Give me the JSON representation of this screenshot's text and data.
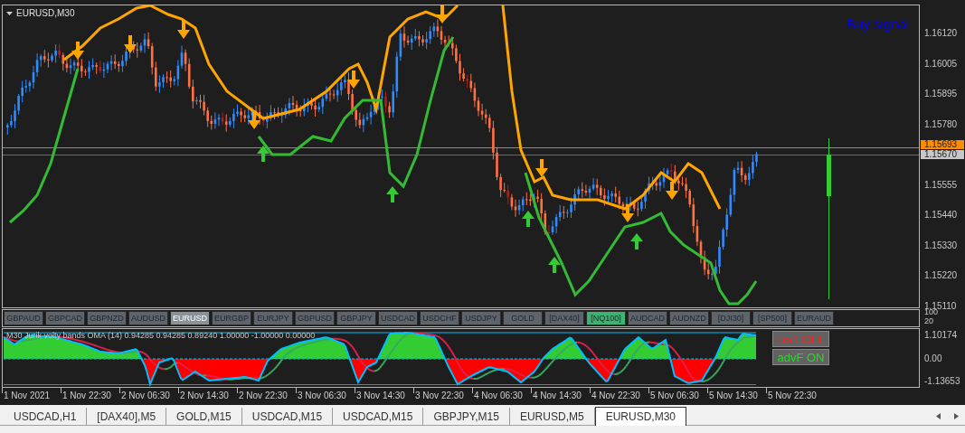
{
  "chart": {
    "symbol": "EURUSD,M30",
    "signal": "Buy signal"
  },
  "price_axis": {
    "ticks": [
      "1.16120",
      "1.16005",
      "1.15895",
      "1.15780",
      "1.15555",
      "1.15440",
      "1.15330",
      "1.15220",
      "1.15110"
    ],
    "bid_tag": "1.15693",
    "last_tag": "1.15670"
  },
  "symbol_buttons": [
    {
      "label": "GBPAUD",
      "selected": false,
      "highlighted": false
    },
    {
      "label": "GBPCAD",
      "selected": false,
      "highlighted": false
    },
    {
      "label": "GBPNZD",
      "selected": false,
      "highlighted": false
    },
    {
      "label": "AUDUSD",
      "selected": false,
      "highlighted": false
    },
    {
      "label": "EURUSD",
      "selected": true,
      "highlighted": false
    },
    {
      "label": "EURGBP",
      "selected": false,
      "highlighted": false
    },
    {
      "label": "EURJPY",
      "selected": false,
      "highlighted": false
    },
    {
      "label": "GBPUSD",
      "selected": false,
      "highlighted": false
    },
    {
      "label": "GBPJPY",
      "selected": false,
      "highlighted": false
    },
    {
      "label": "USDCAD",
      "selected": false,
      "highlighted": false
    },
    {
      "label": "USDCHF",
      "selected": false,
      "highlighted": false
    },
    {
      "label": "USDJPY",
      "selected": false,
      "highlighted": false
    },
    {
      "label": "GOLD",
      "selected": false,
      "highlighted": false
    },
    {
      "label": "[DAX40]",
      "selected": false,
      "highlighted": false
    },
    {
      "label": "[NQ100]",
      "selected": false,
      "highlighted": true
    },
    {
      "label": "AUDCAD",
      "selected": false,
      "highlighted": false
    },
    {
      "label": "AUDNZD",
      "selected": false,
      "highlighted": false
    },
    {
      "label": "[DJI30]",
      "selected": false,
      "highlighted": false
    },
    {
      "label": "[SP500]",
      "selected": false,
      "highlighted": false
    },
    {
      "label": "EURAUD",
      "selected": false,
      "highlighted": false
    }
  ],
  "button_axis": [
    "100",
    "20"
  ],
  "indicator": {
    "title": "M30 Jurik volty bands OMA (14) 0.94285 0.94285 0.89240 1.00000 -1.00000 0.00000",
    "toggles": [
      {
        "label": "Lrs1 OFF",
        "on": false
      },
      {
        "label": "advF ON",
        "on": true
      }
    ],
    "axis": [
      "1.10174",
      "0.00",
      "-1.13653"
    ]
  },
  "time_axis": [
    "1 Nov 2021",
    "1 Nov 22:30",
    "2 Nov 06:30",
    "2 Nov 14:30",
    "2 Nov 22:30",
    "3 Nov 06:30",
    "3 Nov 14:30",
    "3 Nov 22:30",
    "4 Nov 06:30",
    "4 Nov 14:30",
    "4 Nov 22:30",
    "5 Nov 06:30",
    "5 Nov 14:30",
    "5 Nov 22:30"
  ],
  "tabs": [
    {
      "label": "USDCAD,H1",
      "selected": false
    },
    {
      "label": "[DAX40],M5",
      "selected": false
    },
    {
      "label": "GOLD,M15",
      "selected": false
    },
    {
      "label": "USDCAD,M15",
      "selected": false
    },
    {
      "label": "USDCAD,M15",
      "selected": false
    },
    {
      "label": "GBPJPY,M15",
      "selected": false
    },
    {
      "label": "EURUSD,M5",
      "selected": false
    },
    {
      "label": "EURUSD,M30",
      "selected": true
    }
  ]
}
